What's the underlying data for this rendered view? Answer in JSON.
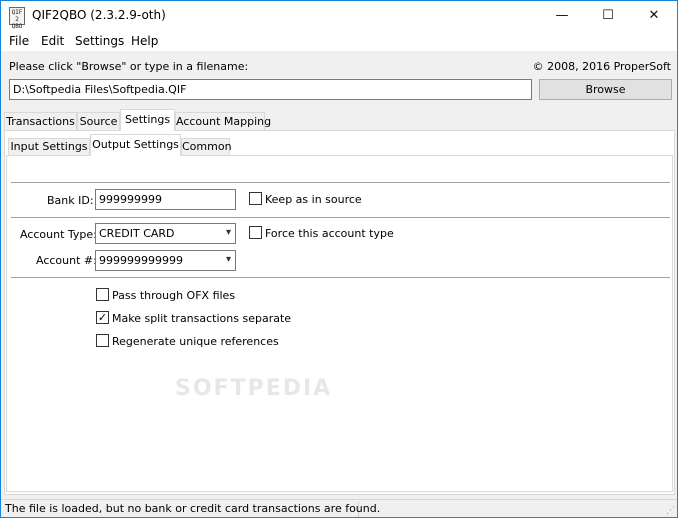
{
  "window": {
    "title": "QIF2QBO (2.3.2.9-oth)",
    "icon_text": "QIF\n2\nQBO",
    "controls": {
      "minimize": "—",
      "maximize": "☐",
      "close": "✕"
    }
  },
  "menu": {
    "items": [
      "File",
      "Edit",
      "Settings",
      "Help"
    ]
  },
  "file_row": {
    "prompt": "Please click \"Browse\" or type in a filename:",
    "copyright": "© 2008, 2016 ProperSoft",
    "filename": "D:\\Softpedia Files\\Softpedia.QIF",
    "browse_label": "Browse"
  },
  "main_tabs": [
    "Transactions",
    "Source",
    "Settings",
    "Account Mapping"
  ],
  "sub_tabs": [
    "Input Settings",
    "Output Settings",
    "Common"
  ],
  "output_settings": {
    "bank_id_label": "Bank ID:",
    "bank_id_value": "999999999",
    "keep_as_source_label": "Keep as in source",
    "keep_as_source_checked": false,
    "account_type_label": "Account Type:",
    "account_type_value": "CREDIT CARD",
    "force_account_type_label": "Force this account type",
    "force_account_type_checked": false,
    "account_number_label": "Account #:",
    "account_number_value": "999999999999",
    "options": [
      {
        "label": "Pass through OFX files",
        "checked": false
      },
      {
        "label": "Make split transactions separate",
        "checked": true
      },
      {
        "label": "Regenerate unique references",
        "checked": false
      }
    ]
  },
  "watermark_text": "SOFTPEDIA",
  "status": {
    "message": "The file is loaded, but no bank or credit card transactions are found."
  },
  "icons": {
    "dropdown": "chevron-down-icon",
    "check": "checkmark-icon",
    "grip": "resize-grip-icon"
  }
}
